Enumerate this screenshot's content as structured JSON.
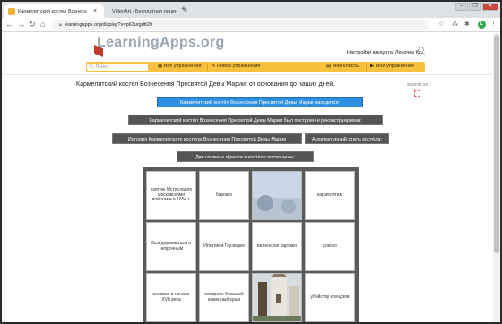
{
  "browser": {
    "tabs": [
      {
        "label": "Кармелитский костел Вознесе",
        "active": true,
        "favicon_color": "#f2b134"
      },
      {
        "label": "VideoArt - Бесплатная лицен",
        "active": false,
        "favicon_color": "#1e6fd9"
      }
    ],
    "new_tab": "+",
    "url": "learningapps.org/display?v=p63urgdtt20",
    "window_buttons": [
      "‒",
      "❐",
      "✕"
    ]
  },
  "page": {
    "logo_text": "LearningApps.org",
    "account_label": "Настройки аккаунта: Леночка Kz.",
    "menu": {
      "search_placeholder": "Поиск",
      "all_exercises": "Все упражнения",
      "new_exercise": "Новое упражнение",
      "my_classes": "Мои классы",
      "my_exercises": "Мои упражнения"
    },
    "title": "Кармелитский костел Вознесения Пресвятой Девы Марии: от основания до наших дней.",
    "date": "2020-04-22",
    "buttons": [
      {
        "label": "Кармелитский костёл Вознесения Пресвятой Девы Марии находится:",
        "selected": true
      },
      {
        "label": "Кармелитский костёл Вознесения Пресвятой Девы Марии был построен и реконструирован:",
        "selected": false
      },
      {
        "label": "История Кармелитского костёла Вознесения Пресвятой Девы Марии",
        "selected": false
      },
      {
        "label": "Архитектурный стиль костёла:",
        "selected": false
      },
      {
        "label": "Две главные фрески в костёле посвящены:",
        "selected": false
      }
    ],
    "puzzle": [
      [
        "взятию Мстиславля московскими войсками в 1654 г.",
        "барокко",
        "",
        "кармелитам"
      ],
      [
        "был деревянным и непрочным",
        "Игнатием Гауэицем",
        "виленское барокко",
        "рококо"
      ],
      [
        "основан в начале XVII века",
        "построен большой каменный храм",
        "",
        "убийству ксендзов"
      ]
    ]
  }
}
